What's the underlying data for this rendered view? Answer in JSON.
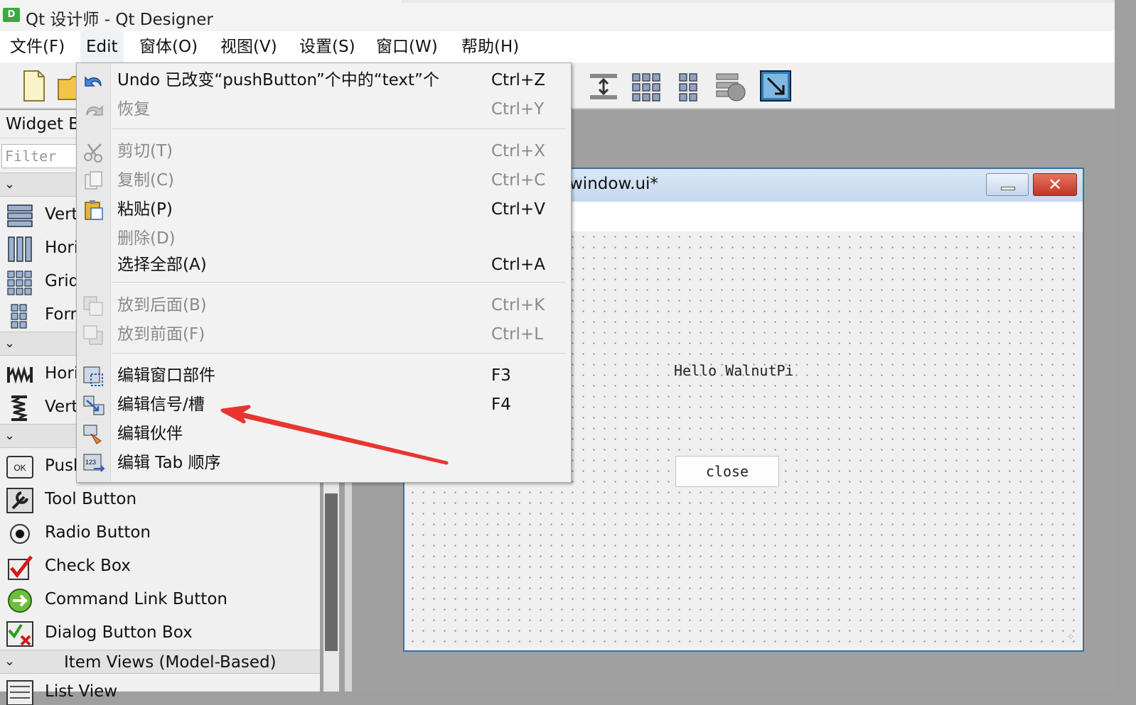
{
  "window": {
    "title": "Qt 设计师 - Qt Designer",
    "app_icon_letter": "D"
  },
  "menubar": {
    "items": [
      {
        "label": "文件(F)"
      },
      {
        "label": "Edit"
      },
      {
        "label": "窗体(O)"
      },
      {
        "label": "视图(V)"
      },
      {
        "label": "设置(S)"
      },
      {
        "label": "窗口(W)"
      },
      {
        "label": "帮助(H)"
      }
    ]
  },
  "edit_menu": {
    "items": [
      {
        "label": "Undo 已改变“pushButton”个中的“text”个",
        "shortcut": "Ctrl+Z",
        "icon": "undo-icon",
        "enabled": true
      },
      {
        "label": "恢复",
        "shortcut": "Ctrl+Y",
        "icon": "redo-icon",
        "enabled": false
      },
      {
        "label": "剪切(T)",
        "shortcut": "Ctrl+X",
        "icon": "scissors-icon",
        "enabled": false
      },
      {
        "label": "复制(C)",
        "shortcut": "Ctrl+C",
        "icon": "copy-icon",
        "enabled": false
      },
      {
        "label": "粘贴(P)",
        "shortcut": "Ctrl+V",
        "icon": "paste-icon",
        "enabled": true
      },
      {
        "label": "删除(D)",
        "shortcut": "",
        "icon": "",
        "enabled": false
      },
      {
        "label": "选择全部(A)",
        "shortcut": "Ctrl+A",
        "icon": "",
        "enabled": true
      },
      {
        "label": "放到后面(B)",
        "shortcut": "Ctrl+K",
        "icon": "send-back-icon",
        "enabled": false
      },
      {
        "label": "放到前面(F)",
        "shortcut": "Ctrl+L",
        "icon": "bring-front-icon",
        "enabled": false
      },
      {
        "label": "编辑窗口部件",
        "shortcut": "F3",
        "icon": "edit-widgets-icon",
        "enabled": true
      },
      {
        "label": "编辑信号/槽",
        "shortcut": "F4",
        "icon": "edit-signals-slots-icon",
        "enabled": true
      },
      {
        "label": "编辑伙伴",
        "shortcut": "",
        "icon": "edit-buddies-icon",
        "enabled": true
      },
      {
        "label": "编辑 Tab 顺序",
        "shortcut": "",
        "icon": "edit-tab-order-icon",
        "enabled": true
      }
    ]
  },
  "widget_box": {
    "title": "Widget Box",
    "filter_placeholder": "Filter",
    "items": [
      {
        "label": "Vertical Layout",
        "icon": "vertical-layout-icon"
      },
      {
        "label": "Horizontal Layout",
        "icon": "horizontal-layout-icon"
      },
      {
        "label": "Grid Layout",
        "icon": "grid-layout-icon"
      },
      {
        "label": "Form Layout",
        "icon": "form-layout-icon"
      },
      {
        "label": "Horizontal Spacer",
        "icon": "horizontal-spacer-icon"
      },
      {
        "label": "Vertical Spacer",
        "icon": "vertical-spacer-icon"
      },
      {
        "label": "Push Button",
        "icon": "push-button-icon"
      },
      {
        "label": "Tool Button",
        "icon": "tool-button-icon"
      },
      {
        "label": "Radio Button",
        "icon": "radio-button-icon"
      },
      {
        "label": "Check Box",
        "icon": "check-box-icon"
      },
      {
        "label": "Command Link Button",
        "icon": "command-link-icon"
      },
      {
        "label": "Dialog Button Box",
        "icon": "dialog-button-box-icon"
      },
      {
        "label": "List View",
        "icon": "list-view-icon"
      }
    ],
    "category_item_views": "Item Views (Model-Based)"
  },
  "form": {
    "title": "window.ui*",
    "label_text": "Hello WalnutPi",
    "button_text": "close"
  }
}
